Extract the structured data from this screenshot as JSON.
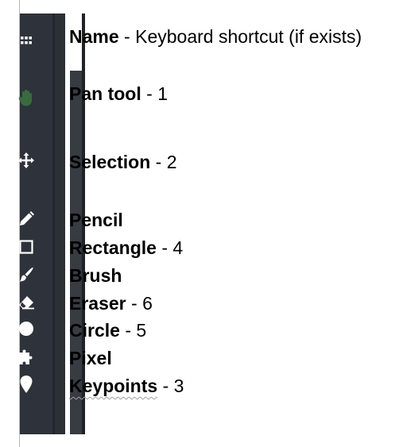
{
  "header": {
    "name_label": "Name",
    "separator": " - ",
    "shortcut_label": "Keyboard shortcut (if exists)"
  },
  "tools": [
    {
      "name": "Pan tool",
      "shortcut": "1",
      "icon": "hand-icon"
    },
    {
      "name": "Selection",
      "shortcut": "2",
      "icon": "move-arrows-icon"
    },
    {
      "name": "Pencil",
      "shortcut": "",
      "icon": "pencil-icon"
    },
    {
      "name": "Rectangle",
      "shortcut": "4",
      "icon": "square-outline-icon"
    },
    {
      "name": "Brush",
      "shortcut": "",
      "icon": "brush-icon"
    },
    {
      "name": "Eraser",
      "shortcut": "6",
      "icon": "eraser-icon"
    },
    {
      "name": "Circle",
      "shortcut": "5",
      "icon": "circle-icon"
    },
    {
      "name": "Pixel",
      "shortcut": "",
      "icon": "puzzle-icon"
    },
    {
      "name": "Keypoints",
      "shortcut": "3",
      "icon": "map-pin-icon"
    }
  ],
  "colors": {
    "toolbar_bg": "#2e323a",
    "icon_white": "#ffffff",
    "icon_active_green": "#3a6b3f"
  }
}
